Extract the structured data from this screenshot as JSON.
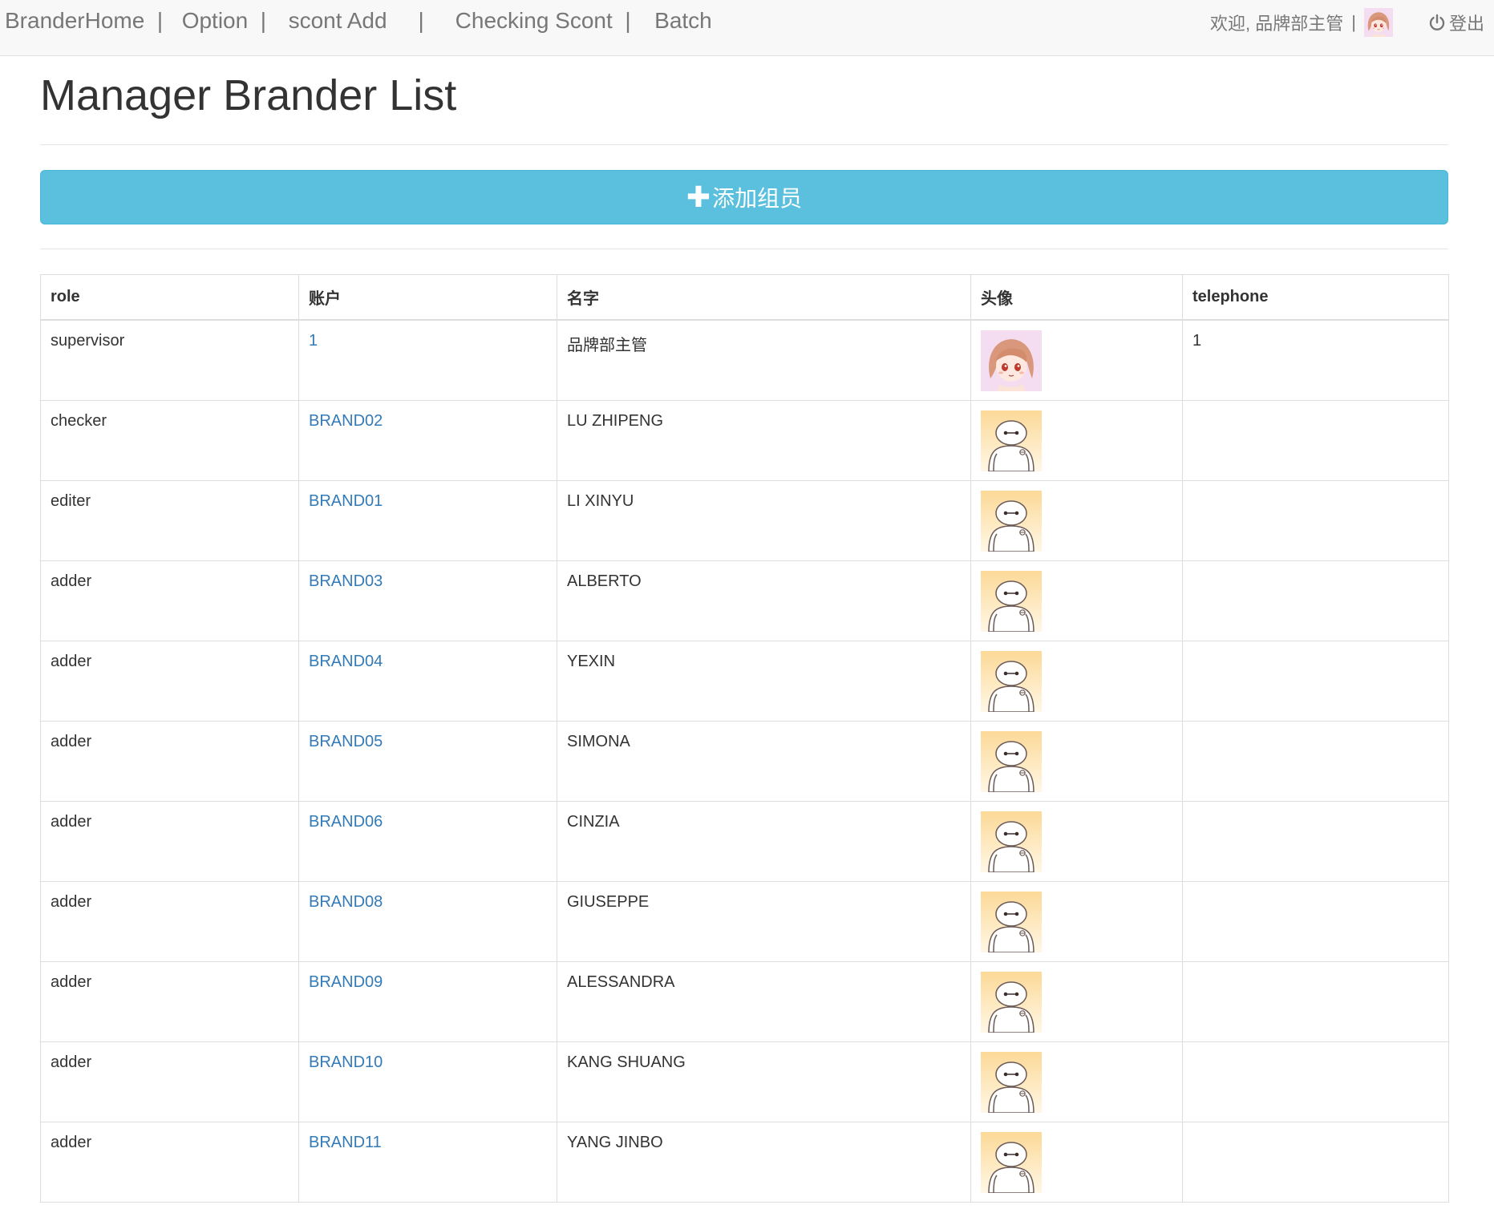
{
  "nav": {
    "links": [
      "BranderHome",
      "Option",
      "scont Add",
      "Checking Scont",
      "Batch"
    ],
    "welcome": "欢迎, 品牌部主管",
    "divider": "|",
    "logout": "登出"
  },
  "page_title": "Manager Brander List",
  "add_button": {
    "icon": "plus-icon",
    "label": "添加组员"
  },
  "table": {
    "headers": [
      "role",
      "账户",
      "名字",
      "头像",
      "telephone"
    ],
    "rows": [
      {
        "role": "supervisor",
        "account": "1",
        "name": "品牌部主管",
        "avatar": "girl-avatar",
        "telephone": "1"
      },
      {
        "role": "checker",
        "account": "BRAND02",
        "name": "LU ZHIPENG",
        "avatar": "robot-avatar",
        "telephone": ""
      },
      {
        "role": "editer",
        "account": "BRAND01",
        "name": "LI XINYU",
        "avatar": "robot-avatar",
        "telephone": ""
      },
      {
        "role": "adder",
        "account": "BRAND03",
        "name": "ALBERTO",
        "avatar": "robot-avatar",
        "telephone": ""
      },
      {
        "role": "adder",
        "account": "BRAND04",
        "name": "YEXIN",
        "avatar": "robot-avatar",
        "telephone": ""
      },
      {
        "role": "adder",
        "account": "BRAND05",
        "name": "SIMONA",
        "avatar": "robot-avatar",
        "telephone": ""
      },
      {
        "role": "adder",
        "account": "BRAND06",
        "name": "CINZIA",
        "avatar": "robot-avatar",
        "telephone": ""
      },
      {
        "role": "adder",
        "account": "BRAND08",
        "name": "GIUSEPPE",
        "avatar": "robot-avatar",
        "telephone": ""
      },
      {
        "role": "adder",
        "account": "BRAND09",
        "name": "ALESSANDRA",
        "avatar": "robot-avatar",
        "telephone": ""
      },
      {
        "role": "adder",
        "account": "BRAND10",
        "name": "KANG SHUANG",
        "avatar": "robot-avatar",
        "telephone": ""
      },
      {
        "role": "adder",
        "account": "BRAND11",
        "name": "YANG JINBO",
        "avatar": "robot-avatar",
        "telephone": ""
      }
    ]
  },
  "colors": {
    "button_bg": "#5bc0de",
    "link": "#337ab7",
    "navbar_bg": "#f8f8f8",
    "girl_avatar_bg": "#f4dcf1",
    "robot_avatar_bg": "#fde7b6"
  }
}
